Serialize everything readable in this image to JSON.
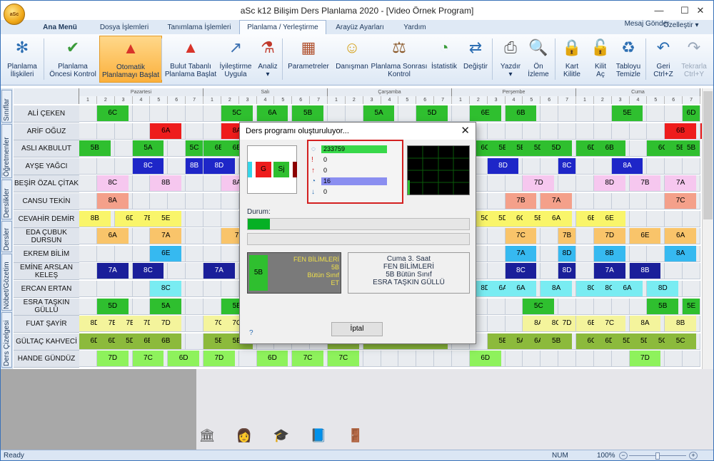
{
  "app": {
    "title": "aSc k12 Bilişim Ders Planlama 2020  -  [Video Örnek Program]",
    "logo_text": "aSc",
    "window_controls": [
      "—",
      "☐",
      "✕"
    ],
    "right_links": {
      "message": "Mesaj Gönder",
      "customize": "Özelleştir ▾"
    }
  },
  "tabs": [
    {
      "label": "Ana Menü",
      "bold": true
    },
    {
      "label": "Dosya İşlemleri"
    },
    {
      "label": "Tanımlama İşlemleri"
    },
    {
      "label": "Planlama / Yerleştirme",
      "active": true
    },
    {
      "label": "Arayüz Ayarları"
    },
    {
      "label": "Yardım"
    }
  ],
  "ribbon": [
    {
      "line1": "Planlama",
      "line2": "İlişkileri",
      "icon": "network-icon",
      "glyph": "✻",
      "color": "#2d6fb3"
    },
    {
      "line1": "Planlama",
      "line2": "Öncesi Kontrol",
      "icon": "check-circle-icon",
      "glyph": "✔",
      "color": "#3a9b3a"
    },
    {
      "line1": "Otomatik",
      "line2": "Planlamayı Başlat",
      "icon": "warning-cone-icon",
      "glyph": "▲",
      "color": "#d8342a",
      "highlight": true
    },
    {
      "line1": "Bulut Tabanlı",
      "line2": "Planlama Başlat",
      "icon": "cloud-cone-icon",
      "glyph": "▲",
      "color": "#d8342a"
    },
    {
      "line1": "İyileştirme",
      "line2": "Uygula",
      "icon": "magic-wand-icon",
      "glyph": "↗",
      "color": "#3a6fb0"
    },
    {
      "line1": "Analiz",
      "line2": "▾",
      "icon": "flask-icon",
      "glyph": "⚗",
      "color": "#c0392b"
    },
    {
      "line1": "Parametreler",
      "line2": "",
      "icon": "abacus-icon",
      "glyph": "▦",
      "color": "#b0512e"
    },
    {
      "line1": "Danışman",
      "line2": "",
      "icon": "advisor-icon",
      "glyph": "☺",
      "color": "#d4a017"
    },
    {
      "line1": "Planlama Sonrası",
      "line2": "Kontrol",
      "icon": "gavel-icon",
      "glyph": "⚖",
      "color": "#8b5a2b"
    },
    {
      "line1": "İstatistik",
      "line2": "",
      "icon": "pie-chart-icon",
      "glyph": "◔",
      "color": "#3a9b3a"
    },
    {
      "line1": "Değiştir",
      "line2": "",
      "icon": "swap-user-icon",
      "glyph": "⇄",
      "color": "#2d6fb3"
    },
    {
      "line1": "Yazdır",
      "line2": "▾",
      "icon": "printer-icon",
      "glyph": "⎙",
      "color": "#555"
    },
    {
      "line1": "Ön",
      "line2": "İzleme",
      "icon": "print-preview-icon",
      "glyph": "🔍",
      "color": "#555"
    },
    {
      "line1": "Kart",
      "line2": "Kilitle",
      "icon": "lock-icon",
      "glyph": "🔒",
      "color": "#2d6fb3"
    },
    {
      "line1": "Kilit",
      "line2": "Aç",
      "icon": "unlock-icon",
      "glyph": "🔓",
      "color": "#2d6fb3"
    },
    {
      "line1": "Tabloyu",
      "line2": "Temizle",
      "icon": "recycle-bin-icon",
      "glyph": "♻",
      "color": "#2d6fb3"
    },
    {
      "line1": "Geri",
      "line2": "Ctrl+Z",
      "icon": "undo-icon",
      "glyph": "↶",
      "color": "#2d6fb3"
    },
    {
      "line1": "Tekrarla",
      "line2": "Ctrl+Y",
      "icon": "redo-icon",
      "glyph": "↷",
      "color": "#9aa8ba",
      "disabled": true
    }
  ],
  "left_tabs": [
    "Sınıflar",
    "Öğretmenler",
    "Derslikler",
    "Dersler",
    "Nöbet/Gözetim",
    "Ders Çizelgesi"
  ],
  "days": [
    "Pazartesi",
    "Salı",
    "Çarşamba",
    "Perşembe",
    "Cuma"
  ],
  "periods": [
    "1",
    "2",
    "3",
    "4",
    "5",
    "6",
    "7"
  ],
  "teachers": [
    {
      "name": "ALİ ÇEKEN",
      "lessons": [
        [
          0,
          1,
          "6C",
          "green"
        ],
        [
          1,
          1,
          "5C",
          "green"
        ],
        [
          1,
          3,
          "6A",
          "green"
        ],
        [
          1,
          5,
          "5B",
          "green"
        ],
        [
          2,
          2,
          "5A",
          "green"
        ],
        [
          2,
          5,
          "5D",
          "green"
        ],
        [
          3,
          1,
          "6E",
          "green"
        ],
        [
          3,
          3,
          "6B",
          "green"
        ],
        [
          4,
          2,
          "5E",
          "green"
        ],
        [
          4,
          6,
          "6D",
          "green"
        ]
      ]
    },
    {
      "name": "ARİF OĞUZ",
      "lessons": [
        [
          0,
          4,
          "6A",
          "red"
        ],
        [
          1,
          1,
          "8A",
          "red"
        ],
        [
          4,
          5,
          "6B",
          "red"
        ],
        [
          4,
          7,
          "7B",
          "red"
        ]
      ]
    },
    {
      "name": "ASLI AKBULUT",
      "lessons": [
        [
          0,
          0,
          "5B",
          "green"
        ],
        [
          0,
          3,
          "5A",
          "green"
        ],
        [
          0,
          6,
          "5C",
          "green"
        ],
        [
          1,
          0,
          "6B",
          "green"
        ],
        [
          1,
          1,
          "6B",
          "green"
        ],
        [
          3,
          1,
          "6C",
          "green"
        ],
        [
          3,
          2,
          "5E",
          "green"
        ],
        [
          3,
          3,
          "5E",
          "green"
        ],
        [
          3,
          4,
          "5D",
          "green"
        ],
        [
          3,
          5,
          "5D",
          "green"
        ],
        [
          4,
          0,
          "6D",
          "green"
        ],
        [
          4,
          1,
          "6B",
          "green"
        ],
        [
          4,
          4,
          "6C",
          "green"
        ],
        [
          4,
          5,
          "5B",
          "green"
        ],
        [
          4,
          6,
          "5B",
          "green"
        ]
      ]
    },
    {
      "name": "AYŞE YAĞCI",
      "lessons": [
        [
          0,
          3,
          "8C",
          "blue"
        ],
        [
          0,
          6,
          "8B",
          "blue"
        ],
        [
          1,
          0,
          "8D",
          "blue"
        ],
        [
          3,
          2,
          "8D",
          "blue"
        ],
        [
          3,
          6,
          "8C",
          "blue"
        ],
        [
          4,
          2,
          "8A",
          "blue"
        ]
      ]
    },
    {
      "name": "BEŞİR ÖZAL ÇİTAK",
      "lessons": [
        [
          0,
          1,
          "8C",
          "pink"
        ],
        [
          0,
          4,
          "8B",
          "pink"
        ],
        [
          1,
          1,
          "8A",
          "pink"
        ],
        [
          3,
          4,
          "7D",
          "pink"
        ],
        [
          4,
          1,
          "8D",
          "pink"
        ],
        [
          4,
          3,
          "7B",
          "pink"
        ],
        [
          4,
          5,
          "7A",
          "pink"
        ]
      ]
    },
    {
      "name": "CANSU TEKİN",
      "lessons": [
        [
          0,
          1,
          "8A",
          "salmon"
        ],
        [
          3,
          3,
          "7B",
          "salmon"
        ],
        [
          3,
          5,
          "7A",
          "salmon"
        ],
        [
          4,
          5,
          "7C",
          "salmon"
        ]
      ]
    },
    {
      "name": "CEVAHİR DEMİR",
      "lessons": [
        [
          0,
          0,
          "8B",
          "yellow"
        ],
        [
          0,
          2,
          "6D",
          "yellow"
        ],
        [
          0,
          3,
          "7B",
          "yellow"
        ],
        [
          0,
          4,
          "5E",
          "yellow"
        ],
        [
          3,
          1,
          "5C",
          "yellow"
        ],
        [
          3,
          2,
          "5D",
          "yellow"
        ],
        [
          3,
          3,
          "6C",
          "yellow"
        ],
        [
          3,
          4,
          "5B",
          "yellow"
        ],
        [
          3,
          5,
          "6A",
          "yellow"
        ],
        [
          4,
          0,
          "6B",
          "yellow"
        ],
        [
          4,
          1,
          "6E",
          "yellow"
        ]
      ]
    },
    {
      "name": "EDA ÇUBUK DURSUN",
      "lessons": [
        [
          0,
          1,
          "6A",
          "orange"
        ],
        [
          0,
          4,
          "7A",
          "orange"
        ],
        [
          1,
          1,
          "7",
          "orange"
        ],
        [
          3,
          3,
          "7C",
          "orange"
        ],
        [
          3,
          6,
          "7B",
          "orange"
        ],
        [
          4,
          1,
          "7D",
          "orange"
        ],
        [
          4,
          3,
          "6E",
          "orange"
        ],
        [
          4,
          5,
          "6A",
          "orange"
        ]
      ]
    },
    {
      "name": "EKREM BİLİM",
      "lessons": [
        [
          0,
          4,
          "6E",
          "cyan"
        ],
        [
          3,
          3,
          "7A",
          "cyan"
        ],
        [
          3,
          6,
          "8D",
          "cyan"
        ],
        [
          4,
          1,
          "8B",
          "cyan"
        ],
        [
          4,
          5,
          "8A",
          "cyan"
        ]
      ]
    },
    {
      "name": "EMİNE ARSLAN KELEŞ",
      "lessons": [
        [
          0,
          1,
          "7A",
          "navy"
        ],
        [
          0,
          3,
          "8C",
          "navy"
        ],
        [
          1,
          0,
          "7A",
          "navy"
        ],
        [
          3,
          3,
          "8C",
          "navy"
        ],
        [
          3,
          6,
          "8D",
          "navy"
        ],
        [
          4,
          1,
          "7A",
          "navy"
        ],
        [
          4,
          3,
          "8B",
          "navy"
        ]
      ]
    },
    {
      "name": "ERCAN ERTAN",
      "lessons": [
        [
          0,
          4,
          "8C",
          "lightcyan"
        ],
        [
          3,
          1,
          "8D",
          "lightcyan"
        ],
        [
          3,
          2,
          "6A",
          "lightcyan"
        ],
        [
          3,
          3,
          "6A",
          "lightcyan"
        ],
        [
          3,
          5,
          "8A",
          "lightcyan"
        ],
        [
          4,
          0,
          "8C",
          "lightcyan"
        ],
        [
          4,
          1,
          "8C",
          "lightcyan"
        ],
        [
          4,
          2,
          "6A",
          "lightcyan"
        ],
        [
          4,
          4,
          "8D",
          "lightcyan"
        ]
      ]
    },
    {
      "name": "ESRA TAŞKIN GÜLLÜ",
      "lessons": [
        [
          0,
          1,
          "5D",
          "green"
        ],
        [
          0,
          4,
          "5A",
          "green"
        ],
        [
          1,
          1,
          "5B",
          "green"
        ],
        [
          3,
          4,
          "5C",
          "green"
        ],
        [
          4,
          4,
          "5B",
          "green"
        ],
        [
          4,
          6,
          "5E",
          "green"
        ]
      ]
    },
    {
      "name": "FUAT ŞAYİR",
      "lessons": [
        [
          0,
          0,
          "8D",
          "lightyellow"
        ],
        [
          0,
          1,
          "7B",
          "lightyellow"
        ],
        [
          0,
          2,
          "7B",
          "lightyellow"
        ],
        [
          0,
          3,
          "7D",
          "lightyellow"
        ],
        [
          0,
          4,
          "7D",
          "lightyellow"
        ],
        [
          1,
          0,
          "7C",
          "lightyellow"
        ],
        [
          1,
          1,
          "7C",
          "lightyellow"
        ],
        [
          3,
          4,
          "8A",
          "lightyellow"
        ],
        [
          3,
          5,
          "8C",
          "lightyellow"
        ],
        [
          3,
          6,
          "7D",
          "lightyellow"
        ],
        [
          4,
          0,
          "6E",
          "lightyellow"
        ],
        [
          4,
          1,
          "7C",
          "lightyellow"
        ],
        [
          4,
          3,
          "8A",
          "lightyellow"
        ],
        [
          4,
          5,
          "8B",
          "lightyellow"
        ]
      ]
    },
    {
      "name": "GÜLTAÇ KAHVECİ",
      "lessons": [
        [
          0,
          0,
          "6D",
          "olive"
        ],
        [
          0,
          1,
          "6D",
          "olive"
        ],
        [
          0,
          2,
          "5D",
          "olive"
        ],
        [
          0,
          3,
          "6B",
          "olive"
        ],
        [
          0,
          4,
          "6B",
          "olive"
        ],
        [
          1,
          0,
          "5E",
          "olive"
        ],
        [
          1,
          1,
          "5E",
          "olive"
        ],
        [
          2,
          0,
          "5A",
          "olive"
        ],
        [
          2,
          2,
          "5B",
          "olive"
        ],
        [
          2,
          3,
          "5D",
          "olive"
        ],
        [
          2,
          4,
          "6A",
          "olive"
        ],
        [
          2,
          5,
          "6A",
          "olive"
        ],
        [
          3,
          2,
          "5E",
          "olive"
        ],
        [
          3,
          3,
          "5A",
          "olive"
        ],
        [
          3,
          4,
          "6A",
          "olive"
        ],
        [
          3,
          5,
          "5B",
          "olive"
        ],
        [
          4,
          0,
          "6C",
          "olive"
        ],
        [
          4,
          1,
          "6D",
          "olive"
        ],
        [
          4,
          2,
          "5D",
          "olive"
        ],
        [
          4,
          3,
          "5D",
          "olive"
        ],
        [
          4,
          4,
          "5C",
          "olive"
        ],
        [
          4,
          5,
          "5C",
          "olive"
        ]
      ]
    },
    {
      "name": "HANDE GÜNDÜZ",
      "lessons": [
        [
          0,
          1,
          "7D",
          "lime"
        ],
        [
          0,
          3,
          "7C",
          "lime"
        ],
        [
          0,
          5,
          "6D",
          "lime"
        ],
        [
          1,
          0,
          "7D",
          "lime"
        ],
        [
          1,
          3,
          "6D",
          "lime"
        ],
        [
          1,
          5,
          "7C",
          "lime"
        ],
        [
          2,
          0,
          "7C",
          "lime"
        ],
        [
          3,
          1,
          "6D",
          "lime"
        ],
        [
          4,
          3,
          "7D",
          "lime"
        ]
      ]
    }
  ],
  "colors": {
    "green": "#2fbf2f",
    "red": "#ee1c1c",
    "blue": "#1e26c8",
    "pink": "#f6c7ef",
    "salmon": "#f4a08a",
    "yellow": "#f9f56a",
    "orange": "#f9c46a",
    "cyan": "#36b9f0",
    "navy": "#1a1f9a",
    "lightcyan": "#79ecf2",
    "lightyellow": "#f4f49c",
    "olive": "#8cba3c",
    "lime": "#8ef25c"
  },
  "dialog": {
    "title": "Ders programı oluşturuluyor...",
    "preview_cells": [
      "G",
      "Sj"
    ],
    "stats": [
      {
        "icon": "clock-icon",
        "value": "233759",
        "bar": 0.85,
        "bar_color": "#38d84a"
      },
      {
        "icon": "exclamation-icon",
        "value": "0",
        "bar": 0
      },
      {
        "icon": "arrow-up-icon",
        "value": "0",
        "bar": 0
      },
      {
        "icon": "gauge-icon",
        "value": "16",
        "bar": 0.85,
        "bar_color": "#8a8ef0"
      },
      {
        "icon": "arrow-down-icon",
        "value": "0",
        "bar": 0
      }
    ],
    "status_label": "Durum:",
    "progress": 0.1,
    "card": {
      "code": "5B",
      "lines": [
        "FEN BİLİMLERİ",
        "5B",
        "Bütün Sınıf",
        "ET"
      ]
    },
    "info": [
      "Cuma 3. Saat",
      "FEN BİLİMLERİ",
      "5B Bütün Sınıf",
      "ESRA TAŞKIN GÜLLÜ"
    ],
    "help_label": "?",
    "cancel_label": "İptal"
  },
  "status": {
    "ready": "Ready",
    "num": "NUM",
    "zoom": "100%"
  },
  "bottom_icons": [
    "school-icon",
    "teacher-icon",
    "graduation-cap-icon",
    "book-icon",
    "door-icon"
  ]
}
